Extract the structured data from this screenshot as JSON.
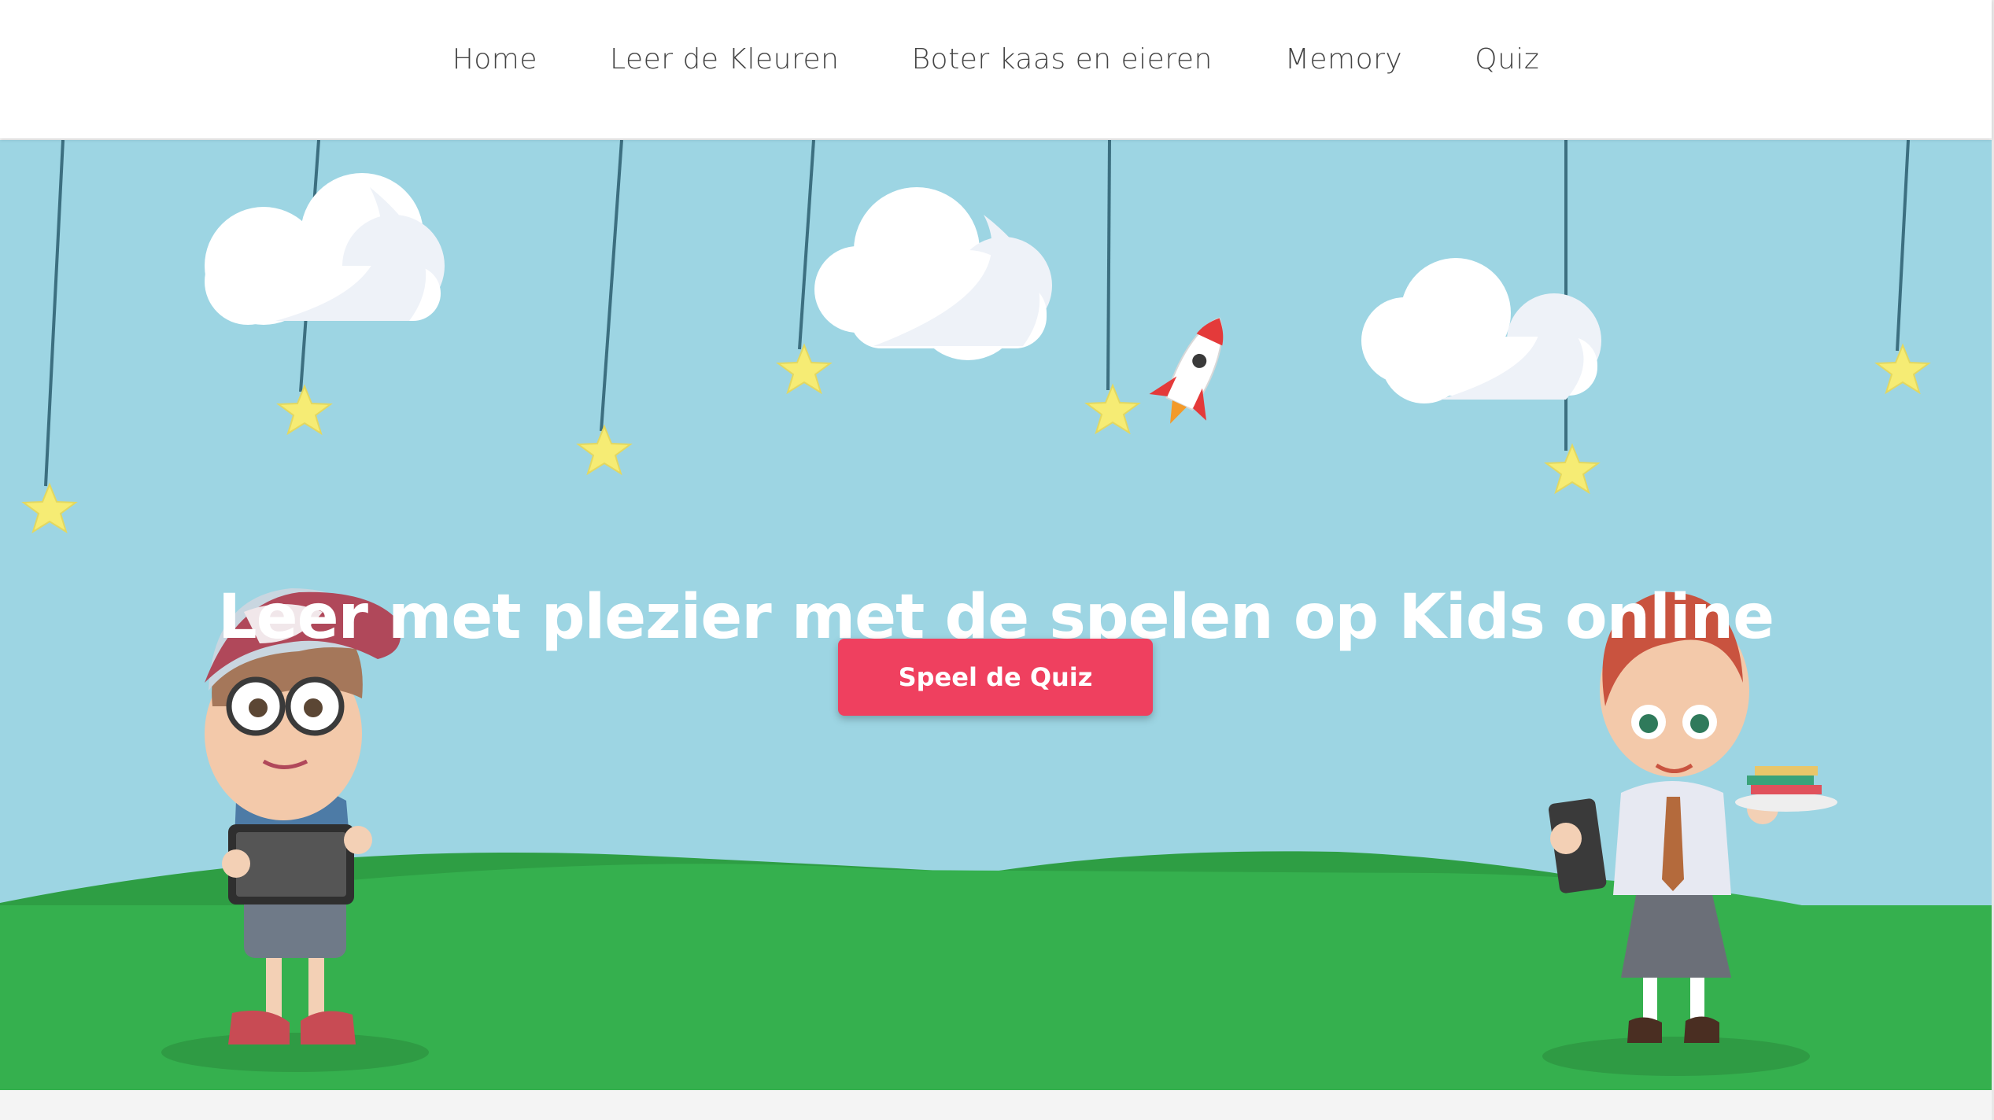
{
  "nav": {
    "items": [
      {
        "label": "Home"
      },
      {
        "label": "Leer de Kleuren"
      },
      {
        "label": "Boter kaas en eieren"
      },
      {
        "label": "Memory"
      },
      {
        "label": "Quiz"
      }
    ]
  },
  "hero": {
    "title": "Leer met plezier met de spelen op Kids online",
    "button_label": "Speel de Quiz"
  },
  "colors": {
    "sky": "#9dd5e3",
    "grass": "#35b04e",
    "hill": "#2e9e44",
    "button": "#ef405f",
    "star": "#f6ec74",
    "string": "#3c6f80"
  },
  "icons": [
    "cloud-icon",
    "star-icon",
    "rocket-icon"
  ]
}
